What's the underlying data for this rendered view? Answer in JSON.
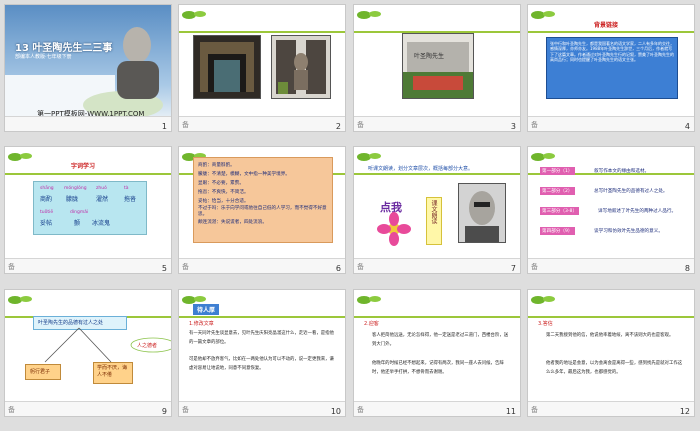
{
  "slides": [
    {
      "num": "1",
      "note": "",
      "title": "13 叶圣陶先生二三事",
      "subtitle": "部编本人教版·七年级下册",
      "footer": "第一PPT模板网-WWW.1PPT.COM"
    },
    {
      "num": "2",
      "note": "备"
    },
    {
      "num": "3",
      "note": "备",
      "sign": "叶圣陶先生"
    },
    {
      "num": "4",
      "note": "备",
      "heading": "背景链接",
      "body": "张中行和叶圣陶先生，都是我国著名的语文学家，二人有多年的交往，感情深厚，亦师亦友。1988年叶圣陶先生辞世，三个月后，作者就写下了这篇文章。作者通过对叶圣陶先生行的记叙，赞美了叶圣陶先生的高尚品行；同时也提醒了叶圣陶先生的语文主张。"
    },
    {
      "num": "5",
      "note": "备",
      "heading": "字词学习",
      "row1_py": [
        "shāng",
        "mónɡlónɡ",
        "zhuó",
        "tà"
      ],
      "row1": [
        "商酌",
        "朦胧",
        "濯然",
        "拖沓"
      ],
      "row2_py": [
        "tuǒtiē",
        "dìnɡmǎi",
        "",
        ""
      ],
      "row2": [
        "妥帖",
        "颤",
        "冰流鬼",
        ""
      ]
    },
    {
      "num": "6",
      "note": "备",
      "lines": [
        "商酌：商量斟酌。",
        "朦胧：不清楚，模糊，文中指一种美学境界。",
        "显眼：不必要，累赘。",
        "拖沓：不爽快，不简洁。",
        "妥帖：恰当，十分合适。",
        "不过于吗：乐于向学问或他往自己低的人学习，而不觉得不好意思。",
        "颠连流湛：失说谎者，四处流浪。"
      ]
    },
    {
      "num": "7",
      "note": "备",
      "heading": "听课文朗读，划分文章层次，概括每部分大意。",
      "stamp": "点我",
      "vertical": "课文朗读"
    },
    {
      "num": "8",
      "note": "备",
      "parts": [
        {
          "label": "第一部分（1）",
          "text": "叙写作本文的缘由和选材。"
        },
        {
          "label": "第二部分（2）",
          "text": "总写叶圣陶先生的品德有过人之处。"
        },
        {
          "label": "第三部分（3-8）",
          "text": "详写地叙述了叶先生的两种过人品行。"
        },
        {
          "label": "第四部分（9）",
          "text": "谈学习和仿效叶先生品德的意义。"
        }
      ]
    },
    {
      "num": "9",
      "note": "备",
      "box": "叶圣陶先生的品德有过人之处",
      "bubble": "人之德者",
      "left": "躬行君子",
      "right": "学而不厌，诲人不倦"
    },
    {
      "num": "10",
      "note": "备",
      "tag": "待人厚",
      "sub": "1.修改文章",
      "para1": "有一天同叶先生谈显意去，见叶先生庆阳亮晶溜这什么，走近一看，是指他的一篇文章的部位。",
      "para2": "可是他却不放弃客气，比如在一两处他认为可以不动的，说一定更我来，谦虚对容易让地说地，同意不同意恢复。"
    },
    {
      "num": "11",
      "note": "备",
      "sub": "2.迎客",
      "para1": "客人拒简他远送，无论怎样得，他一定送是老过三道门，西楼台阶，送到大门外。",
      "para2": "他晚年的时候已经不想起来，记得有两次，我同一座人去问候，告辞时，他还举手打拱，不想骨而去谢谢。"
    },
    {
      "num": "12",
      "note": "备",
      "sub": "3.答信",
      "para1": "第二天我接到他的信，他说他率着地绥，离不该则大的也是客观。",
      "para2": "他者我的地址是会意，以为会离会是离得一些，感到找先是就对工作这么么多年，最后这为我，也都感觉的。"
    }
  ]
}
